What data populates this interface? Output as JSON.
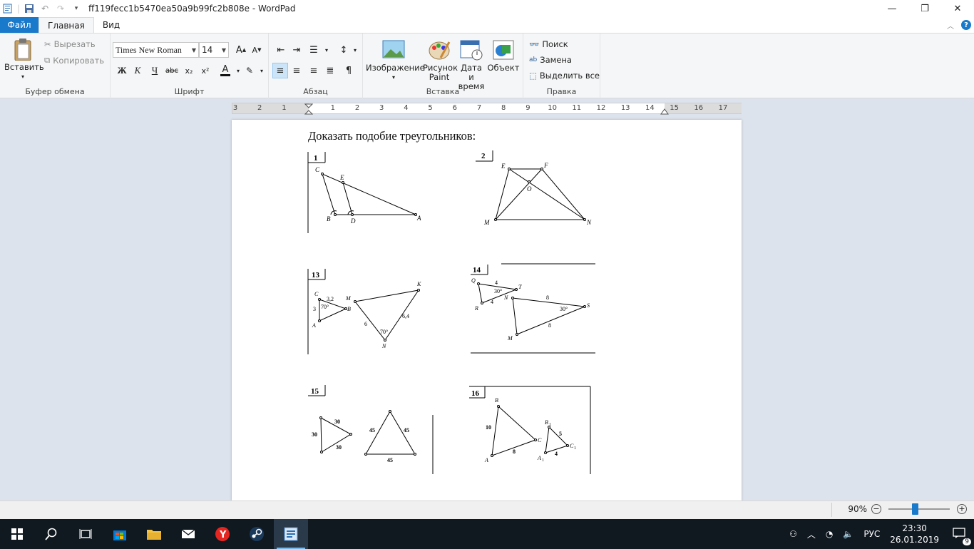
{
  "window": {
    "title": "ff119fecc1b5470ea50a9b99fc2b808e - WordPad"
  },
  "tabs": {
    "file": "Файл",
    "home": "Главная",
    "view": "Вид"
  },
  "ribbon": {
    "clipboard": {
      "paste": "Вставить",
      "cut": "Вырезать",
      "copy": "Копировать",
      "label": "Буфер обмена"
    },
    "font": {
      "family": "Times New Roman",
      "size": "14",
      "label": "Шрифт",
      "bold": "Ж",
      "italic": "К",
      "underline": "Ч",
      "strike": "abc",
      "sub": "x₂",
      "sup": "x²",
      "color_letter": "A"
    },
    "paragraph": {
      "label": "Абзац"
    },
    "insert": {
      "image": "Изображение",
      "paint_1": "Рисунок",
      "paint_2": "Paint",
      "datetime_1": "Дата и",
      "datetime_2": "время",
      "object": "Объект",
      "label": "Вставка"
    },
    "editing": {
      "find": "Поиск",
      "replace": "Замена",
      "select_all": "Выделить все",
      "label": "Правка"
    }
  },
  "ruler": {
    "labels": [
      "3",
      "2",
      "1",
      "1",
      "2",
      "3",
      "4",
      "5",
      "6",
      "7",
      "8",
      "9",
      "10",
      "11",
      "12",
      "13",
      "14",
      "15",
      "16",
      "17"
    ]
  },
  "document": {
    "heading": "Доказать подобие треугольников:",
    "figures": {
      "f1": {
        "num": "1",
        "C": "C",
        "E": "E",
        "B": "B",
        "D": "D",
        "A": "A"
      },
      "f2": {
        "num": "2",
        "E": "E",
        "F": "F",
        "O": "O",
        "M": "M",
        "N": "N"
      },
      "f13": {
        "num": "13",
        "C": "C",
        "A": "A",
        "B": "B",
        "M": "M",
        "K": "K",
        "N": "N",
        "l32": "3,2",
        "l3": "3",
        "l70a": "70°",
        "l6": "6",
        "l64": "6,4",
        "l70b": "70°"
      },
      "f14": {
        "num": "14",
        "Q": "Q",
        "T": "T",
        "R": "R",
        "N": "N",
        "S": "S",
        "M": "M",
        "l4a": "4",
        "l4b": "4",
        "l30a": "30°",
        "l8a": "8",
        "l8b": "8",
        "l30b": "30°"
      },
      "f15": {
        "num": "15",
        "a1": "30",
        "a2": "30",
        "a3": "30",
        "b1": "45",
        "b2": "45",
        "b3": "45"
      },
      "f16": {
        "num": "16",
        "B": "B",
        "A": "A",
        "C": "C",
        "B1": "B",
        "A1": "A",
        "C1": "C",
        "sub": "1",
        "l10": "10",
        "l8": "8",
        "l5": "5",
        "l4": "4"
      }
    }
  },
  "status": {
    "zoom": "90%"
  },
  "taskbar": {
    "lang": "РУС",
    "time": "23:30",
    "date": "26.01.2019",
    "notif": "9"
  }
}
